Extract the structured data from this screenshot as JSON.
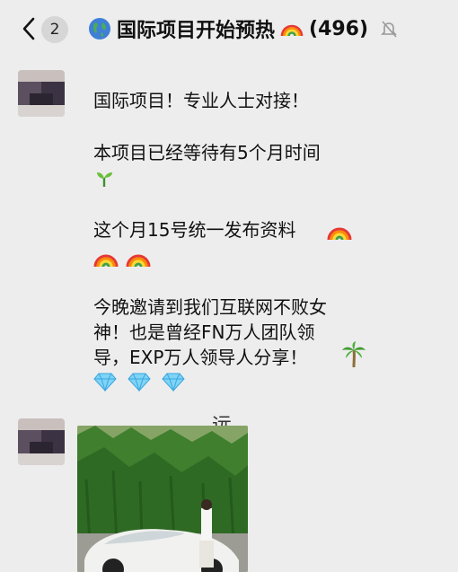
{
  "header": {
    "back_label": "<",
    "unread_count": "2",
    "title": "国际项目开始预热",
    "member_count": "(496)",
    "icons": [
      "chevron-left-icon",
      "globe-icon",
      "rainbow-icon",
      "muted-bell-icon"
    ]
  },
  "messages": [
    {
      "lines": [
        "国际项目！专业人士对接！",
        "本项目已经等待有5个月时间",
        "这个月15号统一发布资料",
        "今晚邀请到我们互联网不败女",
        "神！也是曾经FN万人团队领",
        "导，EXP万人领导人分享！"
      ],
      "emojis": [
        "seedling-icon",
        "rainbow-icon",
        "palm-tree-icon",
        "diamond-icon"
      ]
    },
    {
      "partial_text": "远",
      "image": "photo-woman-with-white-car"
    }
  ],
  "colors": {
    "background": "#ededed",
    "badge": "#d6d6d6"
  }
}
